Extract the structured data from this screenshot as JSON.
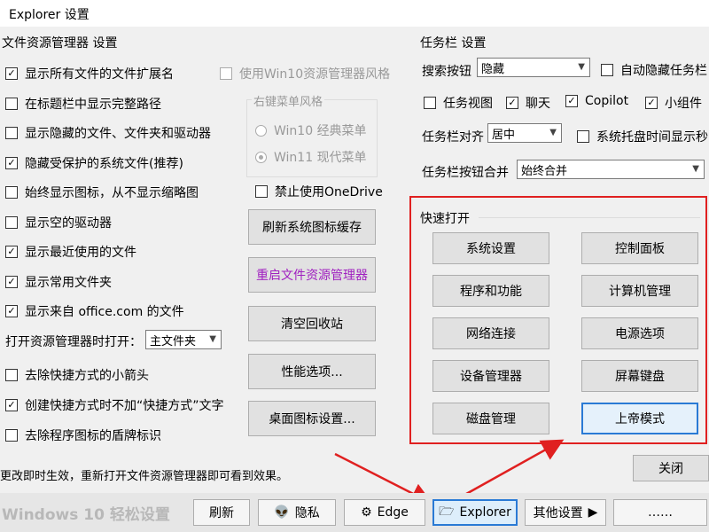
{
  "window": {
    "title": "Explorer 设置"
  },
  "left": {
    "section_title": "文件资源管理器 设置",
    "checkboxes": [
      {
        "label": "显示所有文件的文件扩展名",
        "checked": true
      },
      {
        "label": "在标题栏中显示完整路径",
        "checked": false
      },
      {
        "label": "显示隐藏的文件、文件夹和驱动器",
        "checked": false
      },
      {
        "label": "隐藏受保护的系统文件(推荐)",
        "checked": true
      },
      {
        "label": "始终显示图标，从不显示缩略图",
        "checked": false
      },
      {
        "label": "显示空的驱动器",
        "checked": false
      },
      {
        "label": "显示最近使用的文件",
        "checked": true
      },
      {
        "label": "显示常用文件夹",
        "checked": true
      },
      {
        "label": "显示来自 office.com 的文件",
        "checked": true
      }
    ],
    "open_explorer_label": "打开资源管理器时打开：",
    "open_explorer_value": "主文件夹",
    "checkboxes2": [
      {
        "label": "去除快捷方式的小箭头",
        "checked": false
      },
      {
        "label": "创建快捷方式时不加“快捷方式”文字",
        "checked": true
      },
      {
        "label": "去除程序图标的盾牌标识",
        "checked": false
      }
    ],
    "win10_style_label": "使用Win10资源管理器风格",
    "context_menu_group": "右键菜单风格",
    "radio_win10": "Win10 经典菜单",
    "radio_win11": "Win11 现代菜单",
    "disable_onedrive": "禁止使用OneDrive",
    "buttons": {
      "refresh_icon_cache": "刷新系统图标缓存",
      "restart_explorer": "重启文件资源管理器",
      "empty_recycle": "清空回收站",
      "performance": "性能选项...",
      "desktop_icons": "桌面图标设置..."
    },
    "status_text": "更改即时生效，重新打开文件资源管理器即可看到效果。"
  },
  "taskbar": {
    "section_title": "任务栏 设置",
    "search_label": "搜索按钮",
    "search_value": "隐藏",
    "auto_hide": "自动隐藏任务栏",
    "task_view": "任务视图",
    "chat": "聊天",
    "copilot": "Copilot",
    "widgets": "小组件",
    "align_label": "任务栏对齐",
    "align_value": "居中",
    "tray_seconds": "系统托盘时间显示秒",
    "merge_label": "任务栏按钮合并",
    "merge_value": "始终合并"
  },
  "quick_open": {
    "title": "快速打开",
    "buttons": [
      "系统设置",
      "控制面板",
      "程序和功能",
      "计算机管理",
      "网络连接",
      "电源选项",
      "设备管理器",
      "屏幕键盘",
      "磁盘管理",
      "上帝模式"
    ]
  },
  "close_label": "关闭",
  "bottom": {
    "brand": "Windows 10 轻松设置",
    "refresh": "刷新",
    "privacy": "隐私",
    "edge": "Edge",
    "explorer": "Explorer",
    "more": "其他设置",
    "last": "……"
  }
}
